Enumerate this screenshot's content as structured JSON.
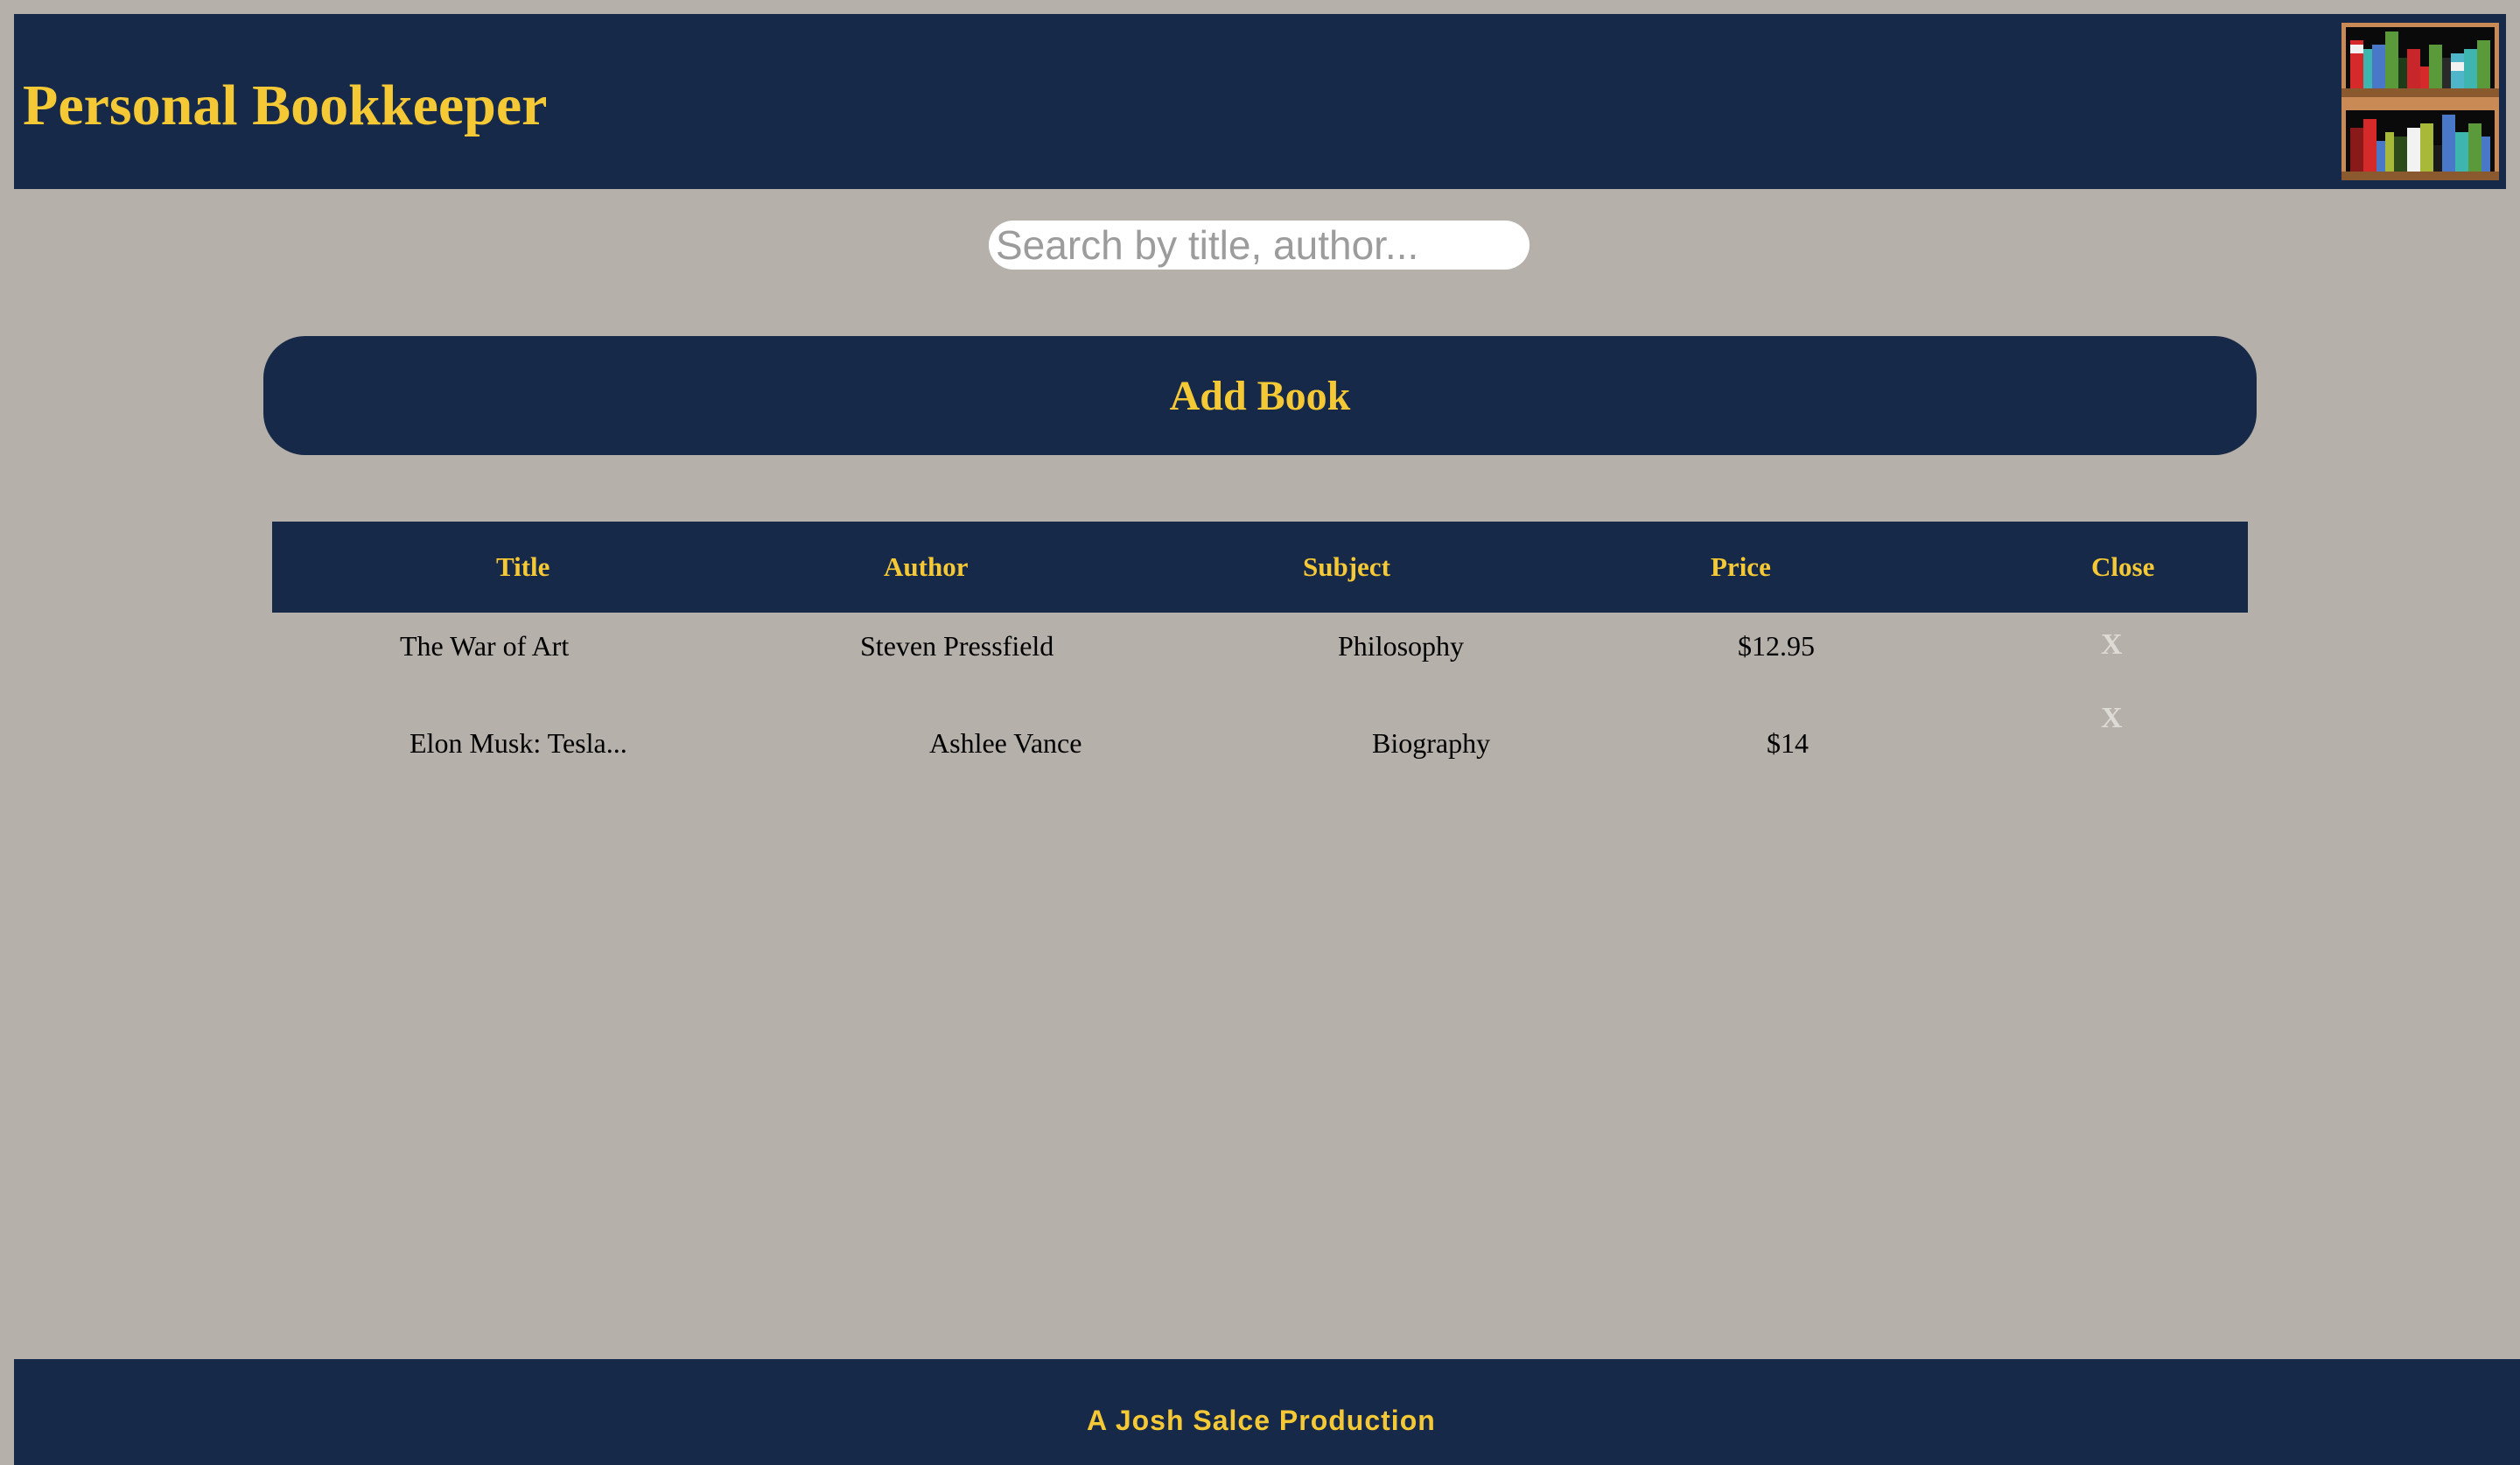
{
  "header": {
    "title": "Personal Bookkeeper",
    "logo_icon": "bookshelf-icon"
  },
  "search": {
    "placeholder": "Search by title, author...",
    "value": ""
  },
  "add_button": {
    "label": "Add Book"
  },
  "table": {
    "columns": [
      "Title",
      "Author",
      "Subject",
      "Price",
      "Close"
    ],
    "rows": [
      {
        "title": "The War of Art",
        "author": "Steven Pressfield",
        "subject": "Philosophy",
        "price": "$12.95",
        "close": "X"
      },
      {
        "title": "Elon Musk: Tesla...",
        "author": "Ashlee Vance",
        "subject": "Biography",
        "price": "$14",
        "close": "X"
      }
    ]
  },
  "footer": {
    "text": "A Josh Salce Production"
  },
  "colors": {
    "background": "#b5b0a9",
    "navy": "#172949",
    "accent": "#f5c935"
  }
}
